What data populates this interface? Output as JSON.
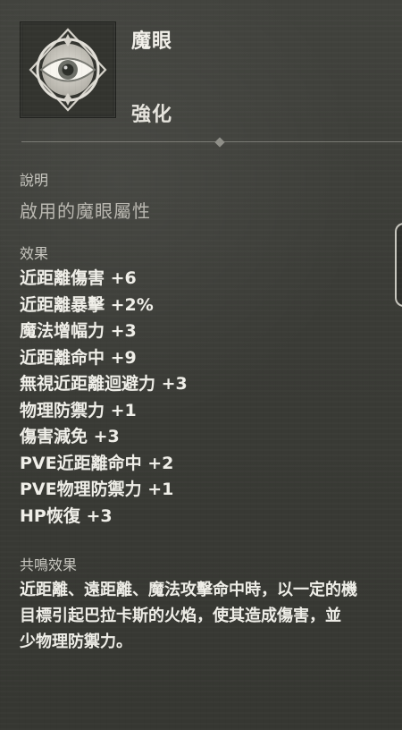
{
  "item": {
    "name": "魔眼",
    "type": "強化",
    "icon": "eye-emblem-icon"
  },
  "sections": {
    "description_title": "說明",
    "description_text": "啟用的魔眼屬性",
    "effects_title": "效果",
    "resonance_title": "共鳴效果"
  },
  "effects": [
    "近距離傷害 +6",
    "近距離暴擊 +2%",
    "魔法增幅力 +3",
    "近距離命中 +9",
    "無視近距離迴避力 +3",
    "物理防禦力 +1",
    "傷害減免 +3",
    "PVE近距離命中 +2",
    "PVE物理防禦力 +1",
    "HP恢復 +3"
  ],
  "resonance": {
    "line1": "近距離、遠距離、魔法攻擊命中時，以一定的機",
    "line2": "目標引起巴拉卡斯的火焰，使其造成傷害，並",
    "line3": "少物理防禦力。"
  },
  "colors": {
    "panel_background": "#3b3c37",
    "primary_text": "#f0efe9",
    "secondary_text": "#bab8b1",
    "section_title": "#c8c7c0"
  }
}
